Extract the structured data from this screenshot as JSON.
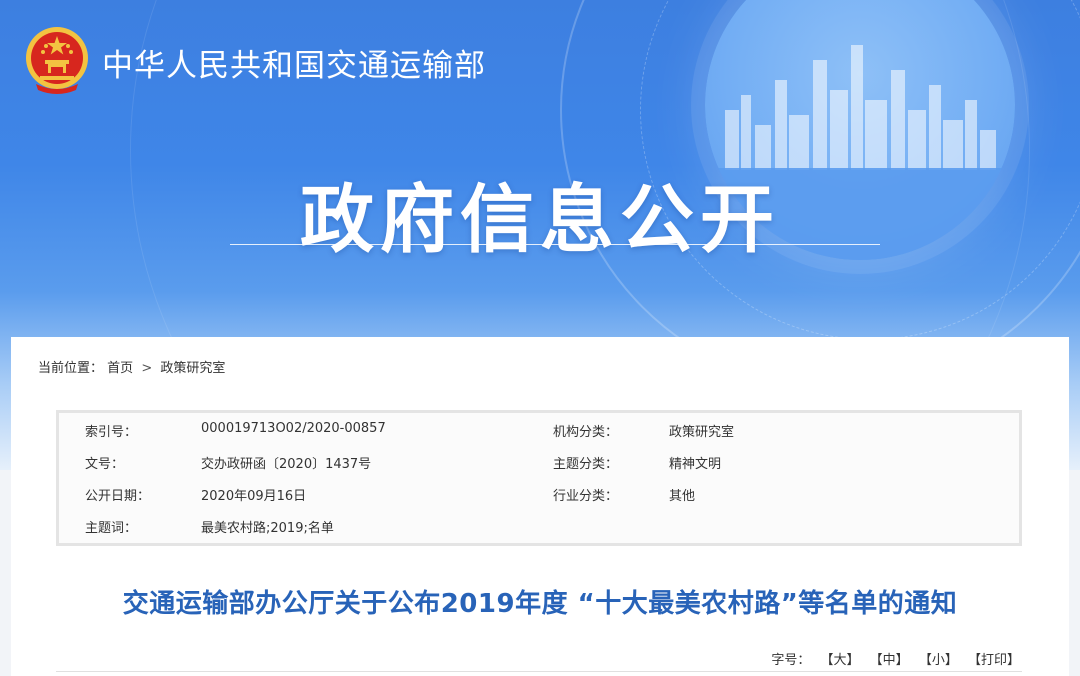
{
  "header": {
    "ministry_name": "中华人民共和国交通运输部",
    "banner_title": "政府信息公开",
    "emblem_icon": "national-emblem-icon"
  },
  "breadcrumb": {
    "label": "当前位置：",
    "items": [
      "首页",
      "政策研究室"
    ],
    "separator": ">"
  },
  "meta": {
    "rows": [
      {
        "k1": "索引号：",
        "v1": "000019713O02/2020-00857",
        "k2": "机构分类：",
        "v2": "政策研究室"
      },
      {
        "k1": "文号：",
        "v1": "交办政研函〔2020〕1437号",
        "k2": "主题分类：",
        "v2": "精神文明"
      },
      {
        "k1": "公开日期：",
        "v1": "2020年09月16日",
        "k2": "行业分类：",
        "v2": "其他"
      },
      {
        "k1": "主题词：",
        "v1": "最美农村路;2019;名单",
        "k2": "",
        "v2": ""
      }
    ]
  },
  "document": {
    "title": "交通运输部办公厅关于公布2019年度 “十大最美农村路”等名单的通知"
  },
  "font_size": {
    "label": "字号：",
    "large": "【大】",
    "medium": "【中】",
    "small": "【小】",
    "print": "【打印】"
  },
  "colors": {
    "banner_blue": "#3f86e8",
    "title_blue": "#2863b8",
    "emblem_red": "#d7261e",
    "emblem_gold": "#f3c341"
  }
}
